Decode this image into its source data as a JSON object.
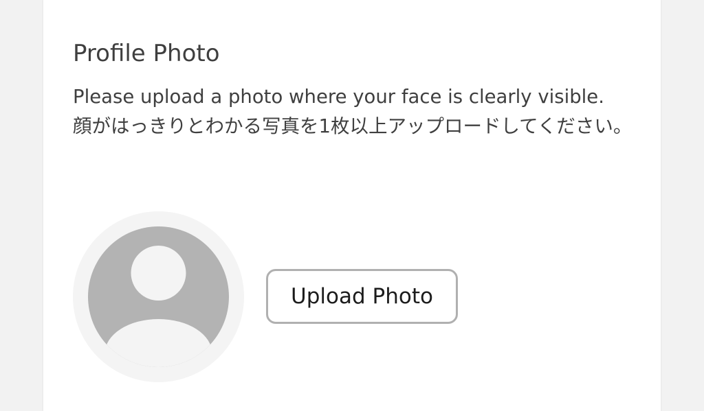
{
  "profile_photo": {
    "title": "Profile Photo",
    "description_en": "Please upload a photo where your face is clearly visible.",
    "description_ja": "顔がはっきりとわかる写真を1枚以上アップロードしてください。",
    "upload_button_label": "Upload Photo",
    "avatar_icon": "user-placeholder-icon"
  },
  "colors": {
    "page_background": "#f2f2f2",
    "card_background": "#ffffff",
    "text": "#3f3f3f",
    "avatar_icon": "#b3b3b3",
    "avatar_ring": "#f4f4f4",
    "button_border": "#b0b0b0"
  }
}
